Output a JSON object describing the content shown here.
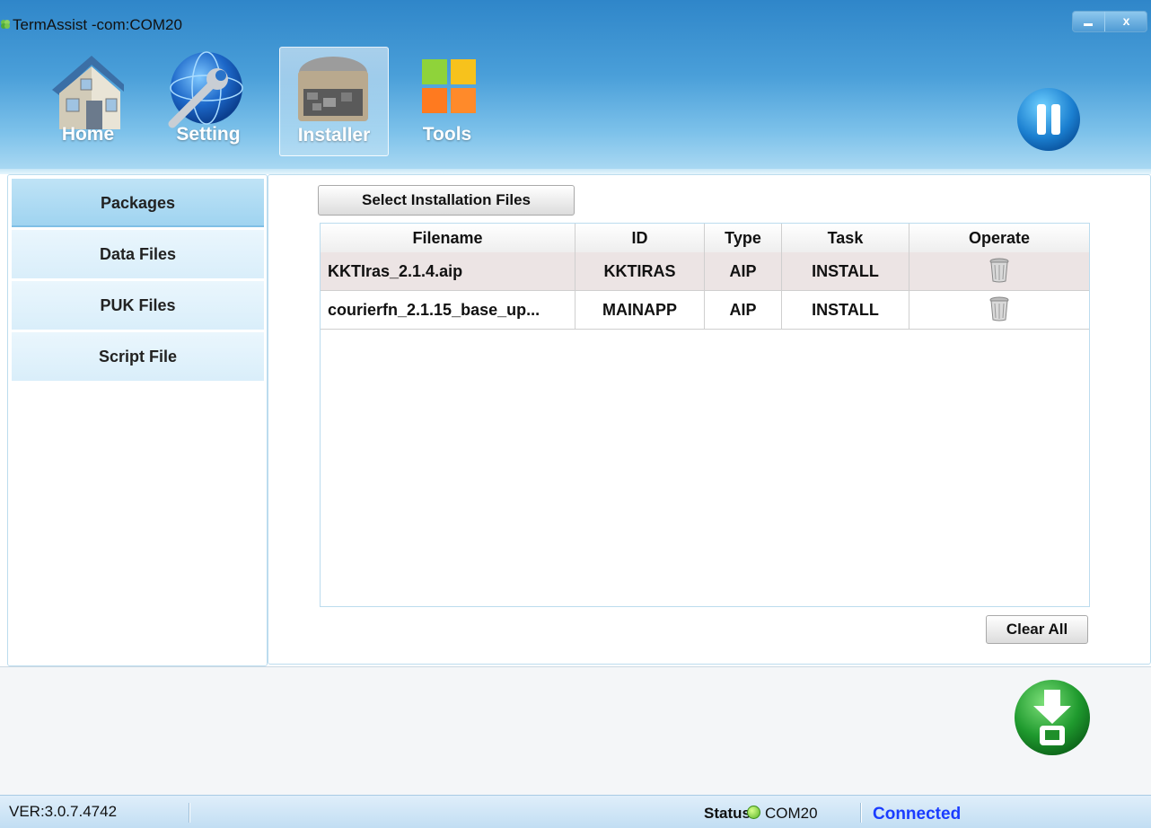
{
  "window": {
    "title": "TermAssist -com:COM20",
    "min_icon": "minimize-icon",
    "close_icon": "close-icon",
    "close_glyph": "x"
  },
  "nav": {
    "items": [
      {
        "label": "Home",
        "icon": "house-icon"
      },
      {
        "label": "Setting",
        "icon": "globe-wrench-icon"
      },
      {
        "label": "Installer",
        "icon": "installer-box-icon",
        "active": true
      },
      {
        "label": "Tools",
        "icon": "tools-tiles-icon"
      }
    ],
    "pause_icon": "pause-icon"
  },
  "sidebar": {
    "items": [
      {
        "label": "Packages",
        "active": true
      },
      {
        "label": "Data Files"
      },
      {
        "label": "PUK Files"
      },
      {
        "label": "Script File"
      }
    ]
  },
  "main": {
    "select_button": "Select Installation Files",
    "clear_button": "Clear All",
    "table": {
      "columns": [
        "Filename",
        "ID",
        "Type",
        "Task",
        "Operate"
      ],
      "rows": [
        {
          "filename": "KKTIras_2.1.4.aip",
          "id": "KKTIRAS",
          "type": "AIP",
          "task": "INSTALL",
          "operate": "trash-icon",
          "selected": true
        },
        {
          "filename": "courierfn_2.1.15_base_up...",
          "id": "MAINAPP",
          "type": "AIP",
          "task": "INSTALL",
          "operate": "trash-icon"
        }
      ]
    }
  },
  "actions": {
    "install_icon": "download-install-icon"
  },
  "statusbar": {
    "version": "VER:3.0.7.4742",
    "status_label": "Status:",
    "port": "COM20",
    "connection": "Connected",
    "connection_color": "#1a3cff",
    "status_dot_color": "#59b62a"
  }
}
